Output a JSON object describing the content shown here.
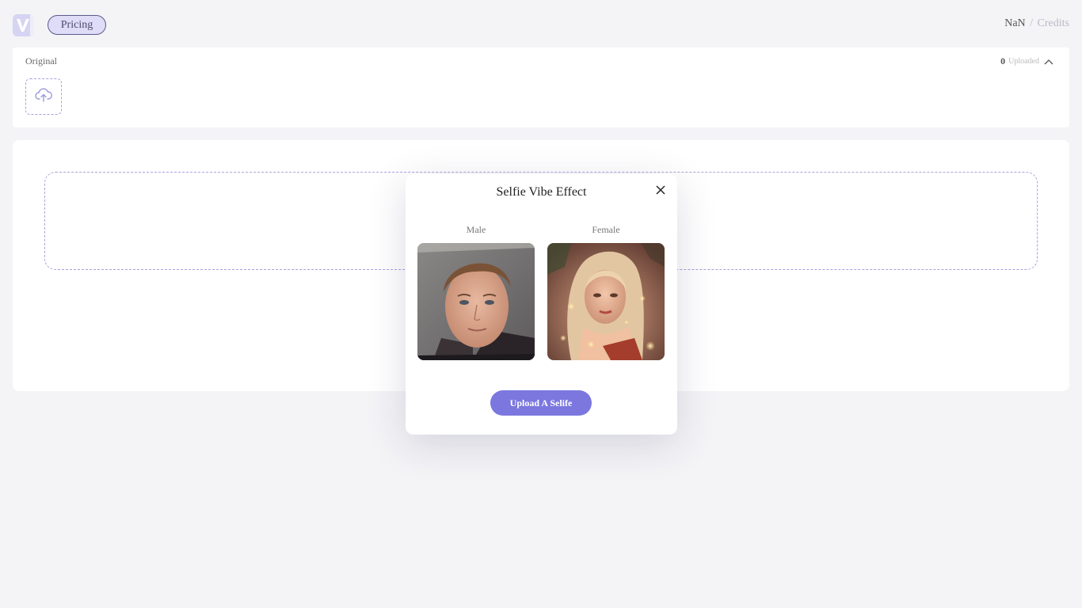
{
  "header": {
    "logo_letter": "V",
    "pricing_label": "Pricing",
    "credits_value": "NaN",
    "credits_separator": "/",
    "credits_label": "Credits"
  },
  "original_panel": {
    "label": "Original",
    "uploaded_count": "0",
    "uploaded_label": "Uploaded"
  },
  "modal": {
    "title": "Selfie Vibe Effect",
    "options": [
      {
        "label": "Male"
      },
      {
        "label": "Female"
      }
    ],
    "upload_button_label": "Upload A Selife"
  },
  "colors": {
    "accent": "#7b77df",
    "page_bg": "#f4f4f7",
    "dashed_border": "#a7a3e0"
  },
  "icons": {
    "upload": "cloud-upload-icon",
    "collapse": "chevron-up-icon",
    "close": "close-icon"
  }
}
